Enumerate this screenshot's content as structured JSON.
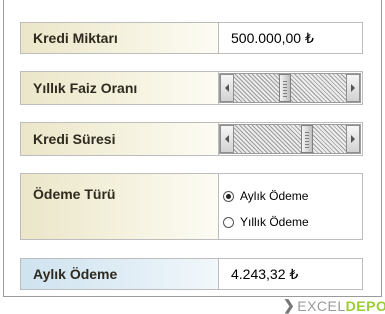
{
  "fields": {
    "loan_amount": {
      "label": "Kredi Miktarı",
      "value": "500.000,00 ₺"
    },
    "interest_rate": {
      "label": "Yıllık Faiz Oranı",
      "level_fraction": 0.45
    },
    "loan_term": {
      "label": "Kredi Süresi",
      "level_fraction": 0.67
    },
    "payment_type": {
      "label": "Ödeme Türü",
      "options": [
        {
          "label": "Aylık Ödeme",
          "selected": true
        },
        {
          "label": "Yıllık Ödeme",
          "selected": false
        }
      ]
    },
    "monthly_payment": {
      "label": "Aylık Ödeme",
      "value": "4.243,32 ₺"
    }
  },
  "logo": {
    "part1": "EXCEL",
    "part2": "DEPO"
  },
  "colors": {
    "label_cream": "#f5f2df",
    "label_blue": "#e2eef6",
    "logo_green": "#9acd32"
  },
  "icons": {
    "scroll_left": "triangle-left-icon",
    "scroll_right": "triangle-right-icon"
  }
}
